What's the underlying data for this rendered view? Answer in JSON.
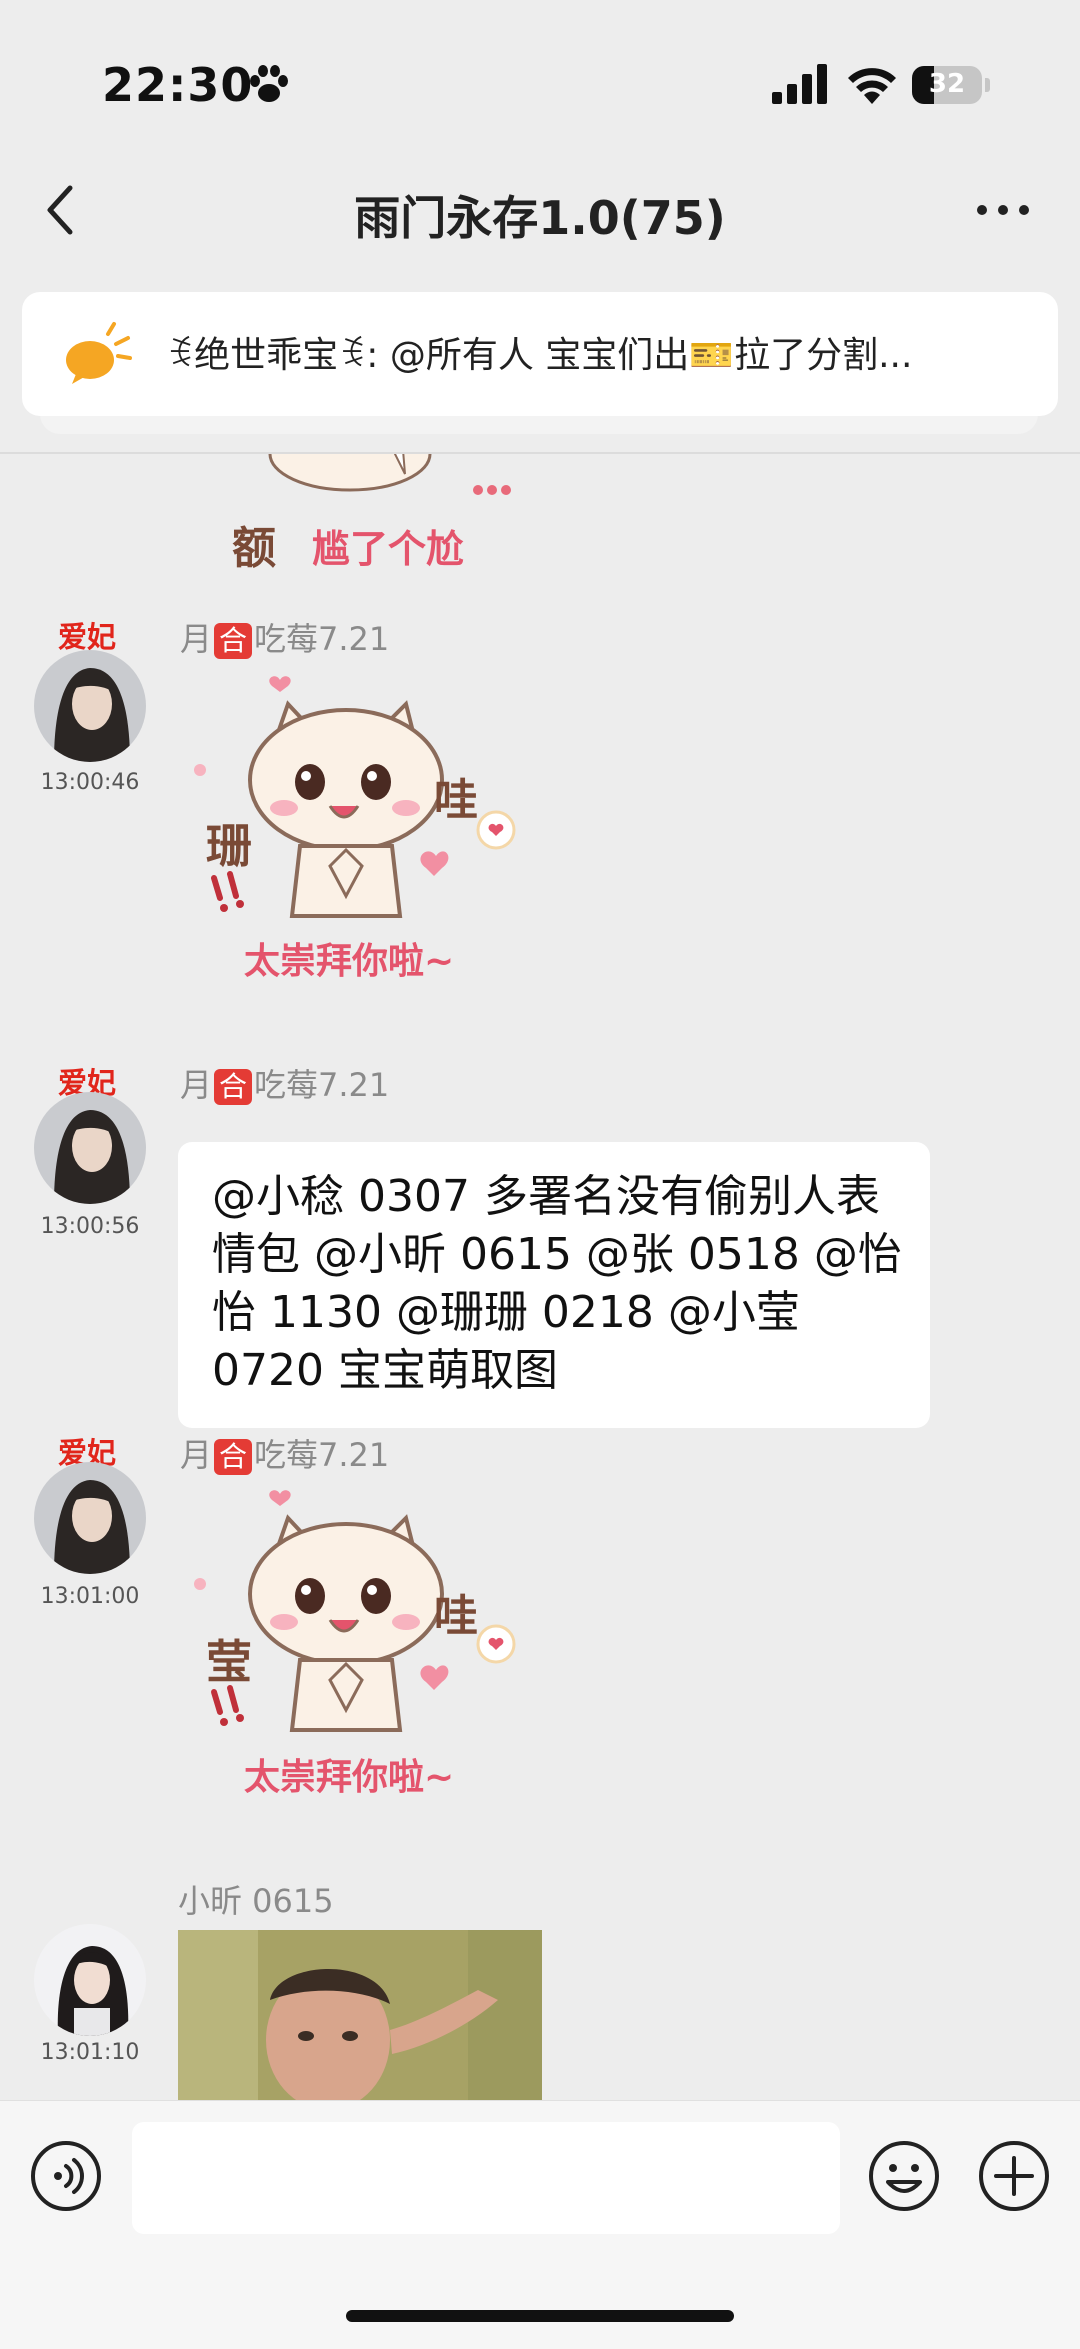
{
  "status_bar": {
    "time": "22:30",
    "battery": "32",
    "battery_level": 0.32
  },
  "nav": {
    "title": "雨门永存1.0(75)"
  },
  "notice": {
    "text": "ꉂ绝世乖宝ꉂ: @所有人 宝宝们出🎫拉了分割..."
  },
  "messages": [
    {
      "title": "爱妃",
      "time": "13:00:46",
      "sender_prefix": "月",
      "sender_badge": "合",
      "sender_suffix": "吃莓7.21",
      "sticker": {
        "left": "珊",
        "right": "哇",
        "bottom": "太崇拜你啦~"
      }
    },
    {
      "title": "爱妃",
      "time": "13:00:56",
      "sender_prefix": "月",
      "sender_badge": "合",
      "sender_suffix": "吃莓7.21",
      "text": "@小稔 0307 多署名没有偷别人表情包 @小昕 0615 @张 0518 @怡怡 1130 @珊珊 0218 @小莹 0720 宝宝萌取图"
    },
    {
      "title": "爱妃",
      "time": "13:01:00",
      "sender_prefix": "月",
      "sender_badge": "合",
      "sender_suffix": "吃莓7.21",
      "sticker": {
        "left": "莹",
        "right": "哇",
        "bottom": "太崇拜你啦~"
      }
    },
    {
      "time": "13:01:10",
      "sender": "小昕 0615"
    }
  ],
  "top_sticker": {
    "left": "额",
    "right": "尴了个尬"
  },
  "input": {
    "placeholder": ""
  },
  "colors": {
    "background": "#ededed",
    "accent_red": "#e43b35",
    "title_red": "#e1251b",
    "notice_icon": "#f5a623"
  }
}
